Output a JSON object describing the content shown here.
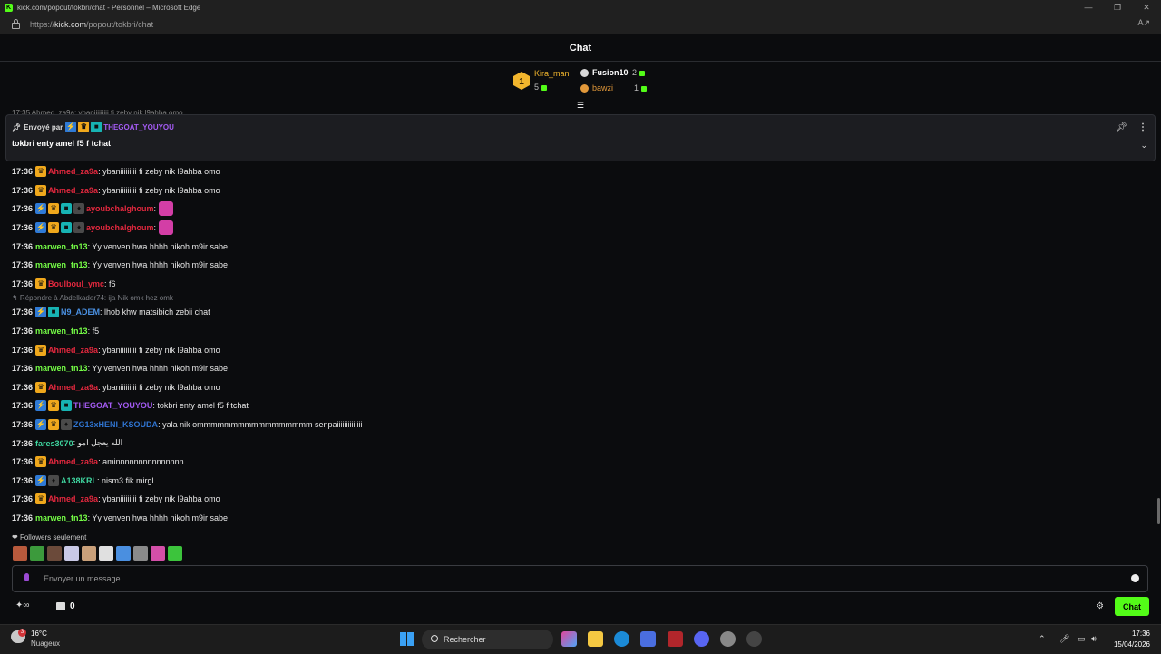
{
  "window": {
    "title": "kick.com/popout/tokbri/chat - Personnel – Microsoft Edge",
    "controls": [
      "—",
      "❐",
      "✕"
    ]
  },
  "address_bar": {
    "prefix": "https://",
    "domain": "kick.com",
    "path": "/popout/tokbri/chat"
  },
  "chat": {
    "title": "Chat"
  },
  "leaderboard": {
    "first": {
      "rank": "1",
      "name": "Kira_man",
      "count": "5"
    },
    "second": {
      "name": "Fusion10",
      "count": "2"
    },
    "third": {
      "name": "bawzi",
      "count": "1"
    }
  },
  "cut_line": "17:35 Ahmed_za9a: ybaniiiiiiiii fi zeby nik l9ahba omo",
  "pinned": {
    "sent_by_label": "Envoyé par",
    "user": "THEGOAT_YOUYOU",
    "message": "tokbri enty amel f5 f tchat"
  },
  "messages": [
    {
      "time": "17:36",
      "badges": [
        "sub"
      ],
      "user": "Ahmed_za9a",
      "color": "#e3283e",
      "text": ": ybaniiiiiiiii fi zeby nik l9ahba omo"
    },
    {
      "time": "17:36",
      "badges": [
        "sub"
      ],
      "user": "Ahmed_za9a",
      "color": "#e3283e",
      "text": ": ybaniiiiiiiii fi zeby nik l9ahba omo"
    },
    {
      "time": "17:36",
      "badges": [
        "vip",
        "sub",
        "og",
        "gift"
      ],
      "user": "ayoubchalghoum",
      "color": "#e3283e",
      "text": ":",
      "emote": true
    },
    {
      "time": "17:36",
      "badges": [
        "vip",
        "sub",
        "og",
        "gift"
      ],
      "user": "ayoubchalghoum",
      "color": "#e3283e",
      "text": ":",
      "emote": true
    },
    {
      "time": "17:36",
      "badges": [],
      "user": "marwen_tn13",
      "color": "#75fd46",
      "text": ": Yy venven hwa hhhh nikoh m9ir sabe"
    },
    {
      "time": "17:36",
      "badges": [],
      "user": "marwen_tn13",
      "color": "#75fd46",
      "text": ": Yy venven hwa hhhh nikoh m9ir sabe"
    },
    {
      "time": "17:36",
      "badges": [
        "sub"
      ],
      "user": "Boulboul_ymc",
      "color": "#e3283e",
      "text": ": f6"
    },
    {
      "reply": "Répondre à Abdelkader74: ija Nik omk hez omk",
      "time": "17:36",
      "badges": [
        "vip",
        "og"
      ],
      "user": "N9_ADEM",
      "color": "#4a90e2",
      "text": ": lhob khw matsibich zebii chat"
    },
    {
      "time": "17:36",
      "badges": [],
      "user": "marwen_tn13",
      "color": "#75fd46",
      "text": ": f5"
    },
    {
      "time": "17:36",
      "badges": [
        "sub"
      ],
      "user": "Ahmed_za9a",
      "color": "#e3283e",
      "text": ": ybaniiiiiiiii fi zeby nik l9ahba omo"
    },
    {
      "time": "17:36",
      "badges": [],
      "user": "marwen_tn13",
      "color": "#75fd46",
      "text": ": Yy venven hwa hhhh nikoh m9ir sabe"
    },
    {
      "time": "17:36",
      "badges": [
        "sub"
      ],
      "user": "Ahmed_za9a",
      "color": "#e3283e",
      "text": ": ybaniiiiiiiii fi zeby nik l9ahba omo"
    },
    {
      "time": "17:36",
      "badges": [
        "vip",
        "sub",
        "og"
      ],
      "user": "THEGOAT_YOUYOU",
      "color": "#a45bf4",
      "text": ": tokbri enty amel f5 f tchat"
    },
    {
      "time": "17:36",
      "badges": [
        "vip",
        "sub",
        "gift"
      ],
      "user": "ZG13xHENI_KSOUDA",
      "color": "#2f74d0",
      "text": ": yala nik ommmmmmmmmmmmmmmmm senpaiiiiiiiiiiiiii"
    },
    {
      "time": "17:36",
      "badges": [],
      "user": "fares3070",
      "color": "#3fd6a0",
      "text": ": الله يعجل امو"
    },
    {
      "time": "17:36",
      "badges": [
        "sub"
      ],
      "user": "Ahmed_za9a",
      "color": "#e3283e",
      "text": ": aminnnnnnnnnnnnnnn"
    },
    {
      "time": "17:36",
      "badges": [
        "vip",
        "gift"
      ],
      "user": "A138KRL",
      "color": "#3fd6a0",
      "text": ": nism3 fik mirgl"
    },
    {
      "time": "17:36",
      "badges": [
        "sub"
      ],
      "user": "Ahmed_za9a",
      "color": "#e3283e",
      "text": ": ybaniiiiiiiii fi zeby nik l9ahba omo"
    },
    {
      "time": "17:36",
      "badges": [],
      "user": "marwen_tn13",
      "color": "#75fd46",
      "text": ": Yy venven hwa hhhh nikoh m9ir sabe"
    }
  ],
  "followers_only": "Followers seulement",
  "emote_colors": [
    "#b85a3c",
    "#3c9a3c",
    "#6b4a3a",
    "#c9c9e6",
    "#c9a07a",
    "#e0e0e0",
    "#4a8fe0",
    "#8a8a8a",
    "#d44fa8",
    "#3cc43c"
  ],
  "input": {
    "placeholder": "Envoyer un message"
  },
  "footer": {
    "count": "0",
    "chat_button": "Chat"
  },
  "taskbar": {
    "weather_badge": "3",
    "temperature": "16°C",
    "weather_desc": "Nuageux",
    "search_placeholder": "Rechercher",
    "time": "17:36",
    "date": "15/04/2026"
  }
}
